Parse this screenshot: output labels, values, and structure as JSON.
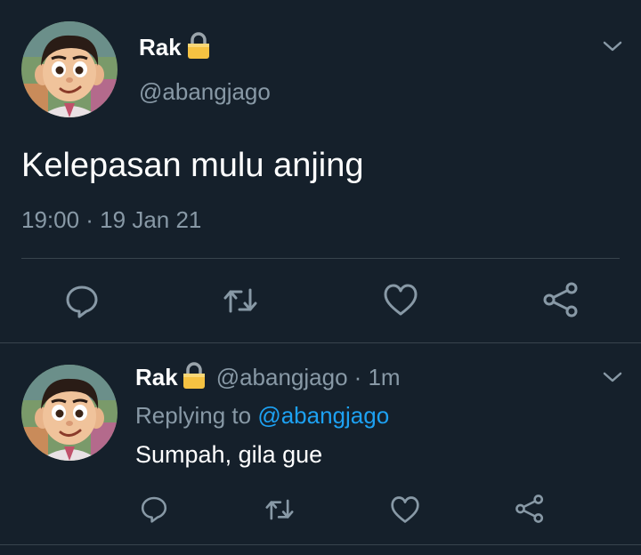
{
  "main_tweet": {
    "author": {
      "name": "Rak",
      "handle": "@abangjago"
    },
    "text": "Kelepasan mulu anjing",
    "timestamp": "19:00 · 19 Jan 21",
    "actions": [
      "reply-icon",
      "retweet-icon",
      "like-icon",
      "share-icon"
    ]
  },
  "reply_tweet": {
    "author": {
      "name": "Rak",
      "handle": "@abangjago",
      "time": "· 1m"
    },
    "replying_prefix": "Replying to",
    "replying_to": "@abangjago",
    "text": "Sumpah, gila gue",
    "actions": [
      "reply-icon",
      "retweet-icon",
      "like-icon",
      "share-icon"
    ]
  },
  "colors": {
    "background": "#15202b",
    "secondary_text": "#8899a6",
    "link": "#1da1f2",
    "divider": "#38444d",
    "lock": "#f5c242"
  }
}
